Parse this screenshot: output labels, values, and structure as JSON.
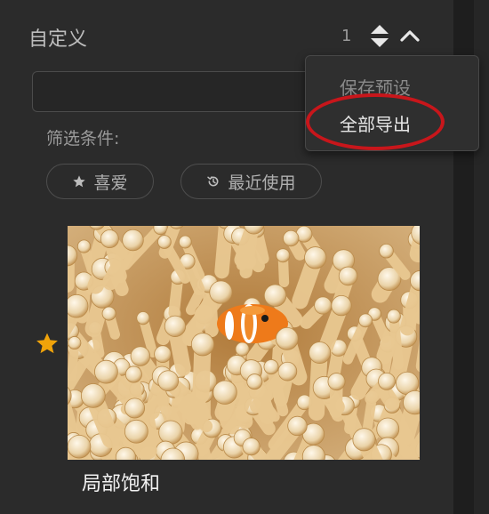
{
  "panel": {
    "title": "自定义",
    "count": "1"
  },
  "search": {
    "placeholder": ""
  },
  "filter": {
    "label": "筛选条件:",
    "chips": [
      {
        "label": "喜爱",
        "icon": "star-icon"
      },
      {
        "label": "最近使用",
        "icon": "history-icon"
      }
    ]
  },
  "menu": {
    "items": [
      {
        "label": "保存预设"
      },
      {
        "label": "全部导出"
      }
    ]
  },
  "preset": {
    "name": "局部饱和",
    "favorited": true
  },
  "colors": {
    "star": "#f0a30a",
    "highlight": "#c8161b",
    "background": "#2b2b2b"
  }
}
